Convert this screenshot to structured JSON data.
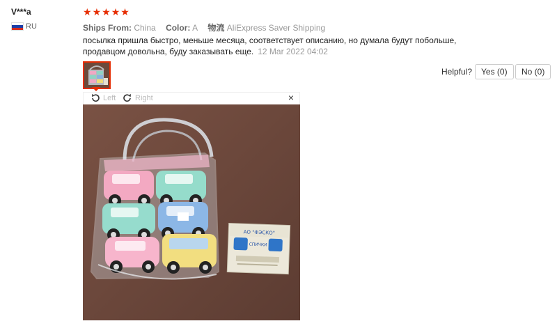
{
  "reviewer": {
    "name": "V***a",
    "country": "RU"
  },
  "rating": {
    "stars": 5,
    "color": "#e62e04"
  },
  "order_info": {
    "ships_from_label": "Ships From:",
    "ships_from_value": "China",
    "color_label": "Color:",
    "color_value": "A",
    "shipping_label": "物流",
    "shipping_value": "AliExpress Saver Shipping"
  },
  "review": {
    "text": "посылка пришла быстро, меньше месяца, соответствует описанию, но думала будут побольше, продавцом довольна, буду заказывать еще.",
    "date": "12 Mar 2022 04:02"
  },
  "helpful": {
    "label": "Helpful?",
    "yes_label": "Yes (0)",
    "no_label": "No (0)"
  },
  "viewer": {
    "rotate_left_label": "Left",
    "rotate_right_label": "Right",
    "close_label": "×"
  },
  "photo": {
    "subject": "toy-cars-in-bag-with-matchbox",
    "matchbox_brand": "АО \"ФЭСКО\"",
    "matchbox_label": "СПИЧКИ"
  }
}
